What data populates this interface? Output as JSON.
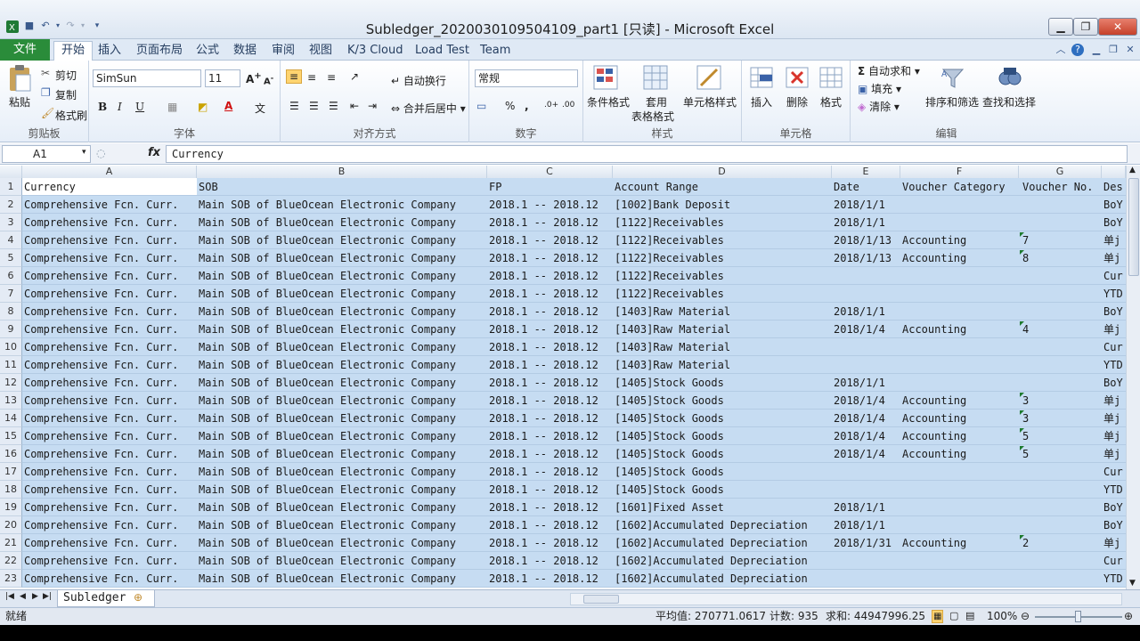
{
  "window": {
    "title": "Subledger_20200301095041​09_part1  [只读] - Microsoft Excel"
  },
  "ribbon_tabs": [
    "文件",
    "开始",
    "插入",
    "页面布局",
    "公式",
    "数据",
    "审阅",
    "视图",
    "K/3 Cloud",
    "Load Test",
    "Team"
  ],
  "ribbon": {
    "clipboard": {
      "paste": "粘贴",
      "cut": "剪切",
      "copy": "复制",
      "format_painter": "格式刷",
      "label": "剪贴板"
    },
    "font": {
      "font_name": "SimSun",
      "font_size": "11",
      "label": "字体"
    },
    "alignment": {
      "wrap": "自动换行",
      "merge": "合并后居中",
      "label": "对齐方式"
    },
    "number": {
      "format": "常规",
      "label": "数字"
    },
    "styles": {
      "conditional": "条件格式",
      "table_line1": "套用",
      "table_line2": "表格格式",
      "cell_styles": "单元格样式",
      "label": "样式"
    },
    "cells": {
      "insert": "插入",
      "delete": "删除",
      "format": "格式",
      "label": "单元格"
    },
    "editing": {
      "autosum": "自动求和",
      "fill": "填充",
      "clear": "清除",
      "sort": "排序和筛选",
      "find": "查找和选择",
      "label": "编辑"
    }
  },
  "formula_bar": {
    "name_box": "A1",
    "fx": "fx",
    "value": "Currency"
  },
  "columns": [
    "A",
    "B",
    "C",
    "D",
    "E",
    "F",
    "G"
  ],
  "column_h_partial": "",
  "rows": [
    [
      "1",
      "Currency",
      "SOB",
      "FP",
      "Account Range",
      "Date",
      "Voucher Category",
      "Voucher No.",
      "Des"
    ],
    [
      "2",
      "Comprehensive Fcn. Curr.",
      "Main SOB of BlueOcean Electronic Company",
      "2018.1 -- 2018.12",
      "[1002]Bank Deposit",
      "2018/1/1",
      "",
      "",
      "BoY"
    ],
    [
      "3",
      "Comprehensive Fcn. Curr.",
      "Main SOB of BlueOcean Electronic Company",
      "2018.1 -- 2018.12",
      "[1122]Receivables",
      "2018/1/1",
      "",
      "",
      "BoY"
    ],
    [
      "4",
      "Comprehensive Fcn. Curr.",
      "Main SOB of BlueOcean Electronic Company",
      "2018.1 -- 2018.12",
      "[1122]Receivables",
      "2018/1/13",
      "Accounting",
      "7",
      "单j"
    ],
    [
      "5",
      "Comprehensive Fcn. Curr.",
      "Main SOB of BlueOcean Electronic Company",
      "2018.1 -- 2018.12",
      "[1122]Receivables",
      "2018/1/13",
      "Accounting",
      "8",
      "单j"
    ],
    [
      "6",
      "Comprehensive Fcn. Curr.",
      "Main SOB of BlueOcean Electronic Company",
      "2018.1 -- 2018.12",
      "[1122]Receivables",
      "",
      "",
      "",
      "Cur"
    ],
    [
      "7",
      "Comprehensive Fcn. Curr.",
      "Main SOB of BlueOcean Electronic Company",
      "2018.1 -- 2018.12",
      "[1122]Receivables",
      "",
      "",
      "",
      "YTD"
    ],
    [
      "8",
      "Comprehensive Fcn. Curr.",
      "Main SOB of BlueOcean Electronic Company",
      "2018.1 -- 2018.12",
      "[1403]Raw Material",
      "2018/1/1",
      "",
      "",
      "BoY"
    ],
    [
      "9",
      "Comprehensive Fcn. Curr.",
      "Main SOB of BlueOcean Electronic Company",
      "2018.1 -- 2018.12",
      "[1403]Raw Material",
      "2018/1/4",
      "Accounting",
      "4",
      "单j"
    ],
    [
      "10",
      "Comprehensive Fcn. Curr.",
      "Main SOB of BlueOcean Electronic Company",
      "2018.1 -- 2018.12",
      "[1403]Raw Material",
      "",
      "",
      "",
      "Cur"
    ],
    [
      "11",
      "Comprehensive Fcn. Curr.",
      "Main SOB of BlueOcean Electronic Company",
      "2018.1 -- 2018.12",
      "[1403]Raw Material",
      "",
      "",
      "",
      "YTD"
    ],
    [
      "12",
      "Comprehensive Fcn. Curr.",
      "Main SOB of BlueOcean Electronic Company",
      "2018.1 -- 2018.12",
      "[1405]Stock Goods",
      "2018/1/1",
      "",
      "",
      "BoY"
    ],
    [
      "13",
      "Comprehensive Fcn. Curr.",
      "Main SOB of BlueOcean Electronic Company",
      "2018.1 -- 2018.12",
      "[1405]Stock Goods",
      "2018/1/4",
      "Accounting",
      "3",
      "单j"
    ],
    [
      "14",
      "Comprehensive Fcn. Curr.",
      "Main SOB of BlueOcean Electronic Company",
      "2018.1 -- 2018.12",
      "[1405]Stock Goods",
      "2018/1/4",
      "Accounting",
      "3",
      "单j"
    ],
    [
      "15",
      "Comprehensive Fcn. Curr.",
      "Main SOB of BlueOcean Electronic Company",
      "2018.1 -- 2018.12",
      "[1405]Stock Goods",
      "2018/1/4",
      "Accounting",
      "5",
      "单j"
    ],
    [
      "16",
      "Comprehensive Fcn. Curr.",
      "Main SOB of BlueOcean Electronic Company",
      "2018.1 -- 2018.12",
      "[1405]Stock Goods",
      "2018/1/4",
      "Accounting",
      "5",
      "单j"
    ],
    [
      "17",
      "Comprehensive Fcn. Curr.",
      "Main SOB of BlueOcean Electronic Company",
      "2018.1 -- 2018.12",
      "[1405]Stock Goods",
      "",
      "",
      "",
      "Cur"
    ],
    [
      "18",
      "Comprehensive Fcn. Curr.",
      "Main SOB of BlueOcean Electronic Company",
      "2018.1 -- 2018.12",
      "[1405]Stock Goods",
      "",
      "",
      "",
      "YTD"
    ],
    [
      "19",
      "Comprehensive Fcn. Curr.",
      "Main SOB of BlueOcean Electronic Company",
      "2018.1 -- 2018.12",
      "[1601]Fixed Asset",
      "2018/1/1",
      "",
      "",
      "BoY"
    ],
    [
      "20",
      "Comprehensive Fcn. Curr.",
      "Main SOB of BlueOcean Electronic Company",
      "2018.1 -- 2018.12",
      "[1602]Accumulated Depreciation",
      "2018/1/1",
      "",
      "",
      "BoY"
    ],
    [
      "21",
      "Comprehensive Fcn. Curr.",
      "Main SOB of BlueOcean Electronic Company",
      "2018.1 -- 2018.12",
      "[1602]Accumulated Depreciation",
      "2018/1/31",
      "Accounting",
      "2",
      "单j"
    ],
    [
      "22",
      "Comprehensive Fcn. Curr.",
      "Main SOB of BlueOcean Electronic Company",
      "2018.1 -- 2018.12",
      "[1602]Accumulated Depreciation",
      "",
      "",
      "",
      "Cur"
    ],
    [
      "23",
      "Comprehensive Fcn. Curr.",
      "Main SOB of BlueOcean Electronic Company",
      "2018.1 -- 2018.12",
      "[1602]Accumulated Depreciation",
      "",
      "",
      "",
      "YTD"
    ]
  ],
  "sheet_tab": "Subledger",
  "status": {
    "ready": "就绪",
    "average": "平均值: 270771.0617",
    "count": "计数: 935",
    "sum": "求和: 44947996.25",
    "zoom": "100%"
  },
  "colors": {
    "selection": "#c6dcf2",
    "file_tab": "#2a8c3a",
    "text_marker": "#1d7a2e"
  }
}
